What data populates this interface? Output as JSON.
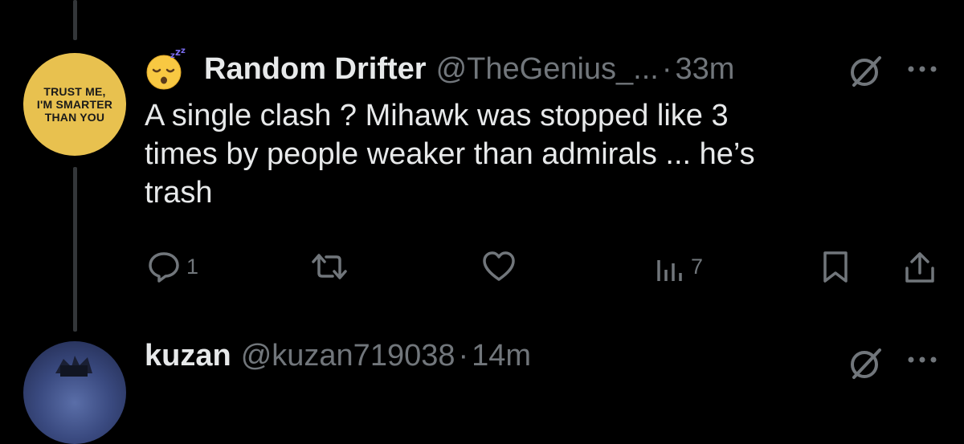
{
  "tweet": {
    "avatar_text": [
      "TRUST ME,",
      "I'M SMARTER",
      "THAN YOU"
    ],
    "badge_emoji": "sleeping-face-emoji",
    "display_name": "Random Drifter",
    "handle": "@TheGenius_...",
    "separator": "·",
    "time": "33m",
    "text_lines": [
      "A single clash ? Mihawk was stopped like 3",
      "times by people weaker than admirals ... he’s",
      "trash"
    ],
    "actions": {
      "reply_count": "1",
      "repost_count": "",
      "like_count": "",
      "views_count": "7"
    },
    "icons": [
      "grok-icon",
      "more-icon",
      "reply-icon",
      "repost-icon",
      "like-icon",
      "views-icon",
      "bookmark-icon",
      "share-icon"
    ]
  },
  "next_tweet": {
    "display_name": "kuzan",
    "handle": "@kuzan719038",
    "separator": "·",
    "time": "14m"
  },
  "colors": {
    "background": "#000000",
    "text_primary": "#e7e9ea",
    "text_secondary": "#71767b",
    "thread_line": "#333639",
    "avatar_bg": "#e8c14f"
  }
}
